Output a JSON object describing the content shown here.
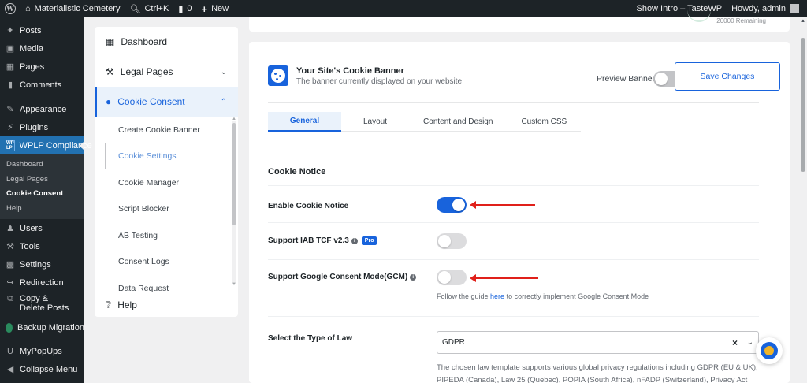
{
  "adminbar": {
    "site_name": "Materialistic Cemetery",
    "search_shortcut": "Ctrl+K",
    "comments_count": "0",
    "new_label": "New",
    "show_intro": "Show Intro – TasteWP",
    "howdy": "Howdy, admin"
  },
  "sidebar": {
    "items": [
      {
        "label": "Posts",
        "icon": "pushpin-icon"
      },
      {
        "label": "Media",
        "icon": "media-icon"
      },
      {
        "label": "Pages",
        "icon": "pages-icon"
      },
      {
        "label": "Comments",
        "icon": "comment-icon"
      },
      {
        "label": "Appearance",
        "icon": "brush-icon"
      },
      {
        "label": "Plugins",
        "icon": "plugin-icon"
      },
      {
        "label": "WPLP Compliance",
        "icon": "wplp-icon"
      },
      {
        "label": "Users",
        "icon": "users-icon"
      },
      {
        "label": "Tools",
        "icon": "wrench-icon"
      },
      {
        "label": "Settings",
        "icon": "settings-icon"
      },
      {
        "label": "Redirection",
        "icon": "redirect-icon"
      },
      {
        "label": "Copy & Delete Posts",
        "icon": "copy-icon"
      },
      {
        "label": "Backup Migration",
        "icon": "backup-icon"
      },
      {
        "label": "MyPopUps",
        "icon": "popup-icon"
      },
      {
        "label": "Collapse Menu",
        "icon": "collapse-icon"
      }
    ],
    "submenu": [
      "Dashboard",
      "Legal Pages",
      "Cookie Consent",
      "Help"
    ]
  },
  "leftpanel": {
    "dashboard": "Dashboard",
    "legal_pages": "Legal Pages",
    "cookie_consent": "Cookie Consent",
    "subitems": [
      "Create Cookie Banner",
      "Cookie Settings",
      "Cookie Manager",
      "Script Blocker",
      "AB Testing",
      "Consent Logs",
      "Data Request"
    ],
    "help": "Help"
  },
  "topcard": {
    "remaining": "20000 Remaining"
  },
  "main": {
    "title": "Your Site's Cookie Banner",
    "subtitle": "The banner currently displayed on your website.",
    "preview_label": "Preview Banner",
    "save_label": "Save Changes",
    "tabs": [
      "General",
      "Layout",
      "Content and Design",
      "Custom CSS"
    ],
    "section_title": "Cookie Notice",
    "rows": {
      "enable_notice": {
        "label": "Enable Cookie Notice",
        "on": true
      },
      "iab": {
        "label": "Support IAB TCF v2.3",
        "badge": "Pro",
        "on": false
      },
      "gcm": {
        "label": "Support Google Consent Mode(GCM)",
        "on": false
      }
    },
    "gcm_helper_pre": "Follow the guide ",
    "gcm_helper_link": "here",
    "gcm_helper_post": " to correctly implement Google Consent Mode",
    "law_label": "Select the Type of Law",
    "law_value": "GDPR",
    "law_desc": "The chosen law template supports various global privacy regulations including GDPR (EU & UK), PIPEDA (Canada), Law 25 (Quebec), POPIA (South Africa), nFADP (Switzerland), Privacy Act"
  },
  "colors": {
    "accent": "#1863dc",
    "admin_dark": "#1d2327",
    "wp_blue": "#2271b1",
    "arrow_red": "#e0201a"
  }
}
